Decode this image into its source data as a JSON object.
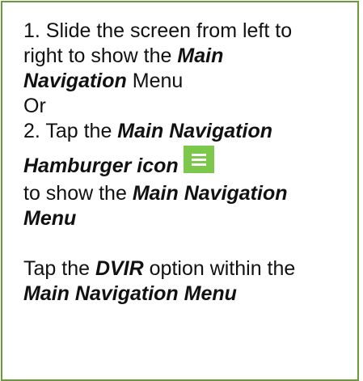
{
  "step1": {
    "line1": "1.  Slide the screen from left to",
    "line2_prefix": "right to show the ",
    "line2_em": "Main",
    "line3_em": "Navigation",
    "line3_suffix": " Menu"
  },
  "or_text": "Or",
  "step2": {
    "line1_prefix": "2.  Tap the ",
    "line1_em": "Main Navigation",
    "line2_em": "Hamburger icon",
    "icon": "hamburger-menu-icon",
    "line3_prefix": "to show the ",
    "line3_em": "Main Navigation",
    "line4_em": "Menu"
  },
  "step3": {
    "line1_prefix": "Tap the ",
    "line1_em": "DVIR",
    "line1_suffix": " option within the",
    "line2_em": "Main Navigation Menu"
  },
  "colors": {
    "border": "#6a9a3a",
    "icon_bg": "#7cc84a"
  }
}
